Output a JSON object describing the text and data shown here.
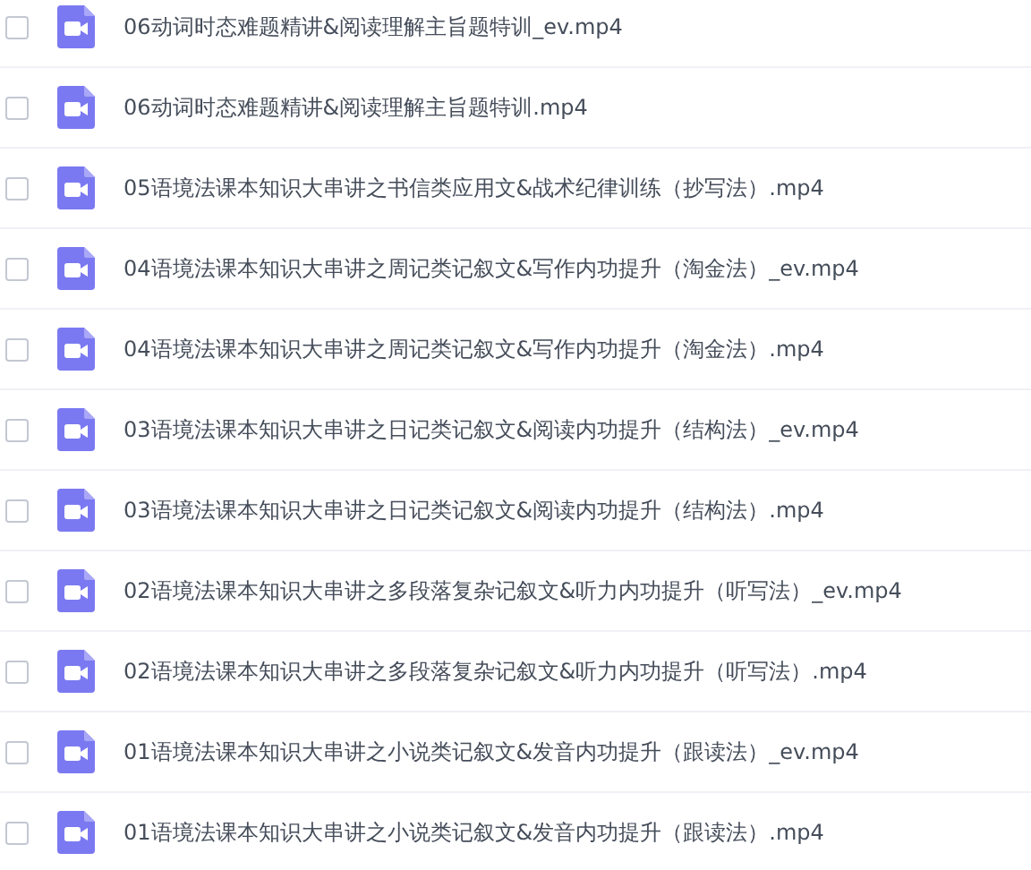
{
  "files": [
    {
      "name": "06动词时态难题精讲&阅读理解主旨题特训_ev.mp4",
      "checked": false
    },
    {
      "name": "06动词时态难题精讲&阅读理解主旨题特训.mp4",
      "checked": false
    },
    {
      "name": "05语境法课本知识大串讲之书信类应用文&战术纪律训练（抄写法）.mp4",
      "checked": false
    },
    {
      "name": "04语境法课本知识大串讲之周记类记叙文&写作内功提升（淘金法）_ev.mp4",
      "checked": false
    },
    {
      "name": "04语境法课本知识大串讲之周记类记叙文&写作内功提升（淘金法）.mp4",
      "checked": false
    },
    {
      "name": "03语境法课本知识大串讲之日记类记叙文&阅读内功提升（结构法）_ev.mp4",
      "checked": false
    },
    {
      "name": "03语境法课本知识大串讲之日记类记叙文&阅读内功提升（结构法）.mp4",
      "checked": false
    },
    {
      "name": "02语境法课本知识大串讲之多段落复杂记叙文&听力内功提升（听写法）_ev.mp4",
      "checked": false
    },
    {
      "name": "02语境法课本知识大串讲之多段落复杂记叙文&听力内功提升（听写法）.mp4",
      "checked": false
    },
    {
      "name": "01语境法课本知识大串讲之小说类记叙文&发音内功提升（跟读法）_ev.mp4",
      "checked": false
    },
    {
      "name": "01语境法课本知识大串讲之小说类记叙文&发音内功提升（跟读法）.mp4",
      "checked": false
    }
  ]
}
